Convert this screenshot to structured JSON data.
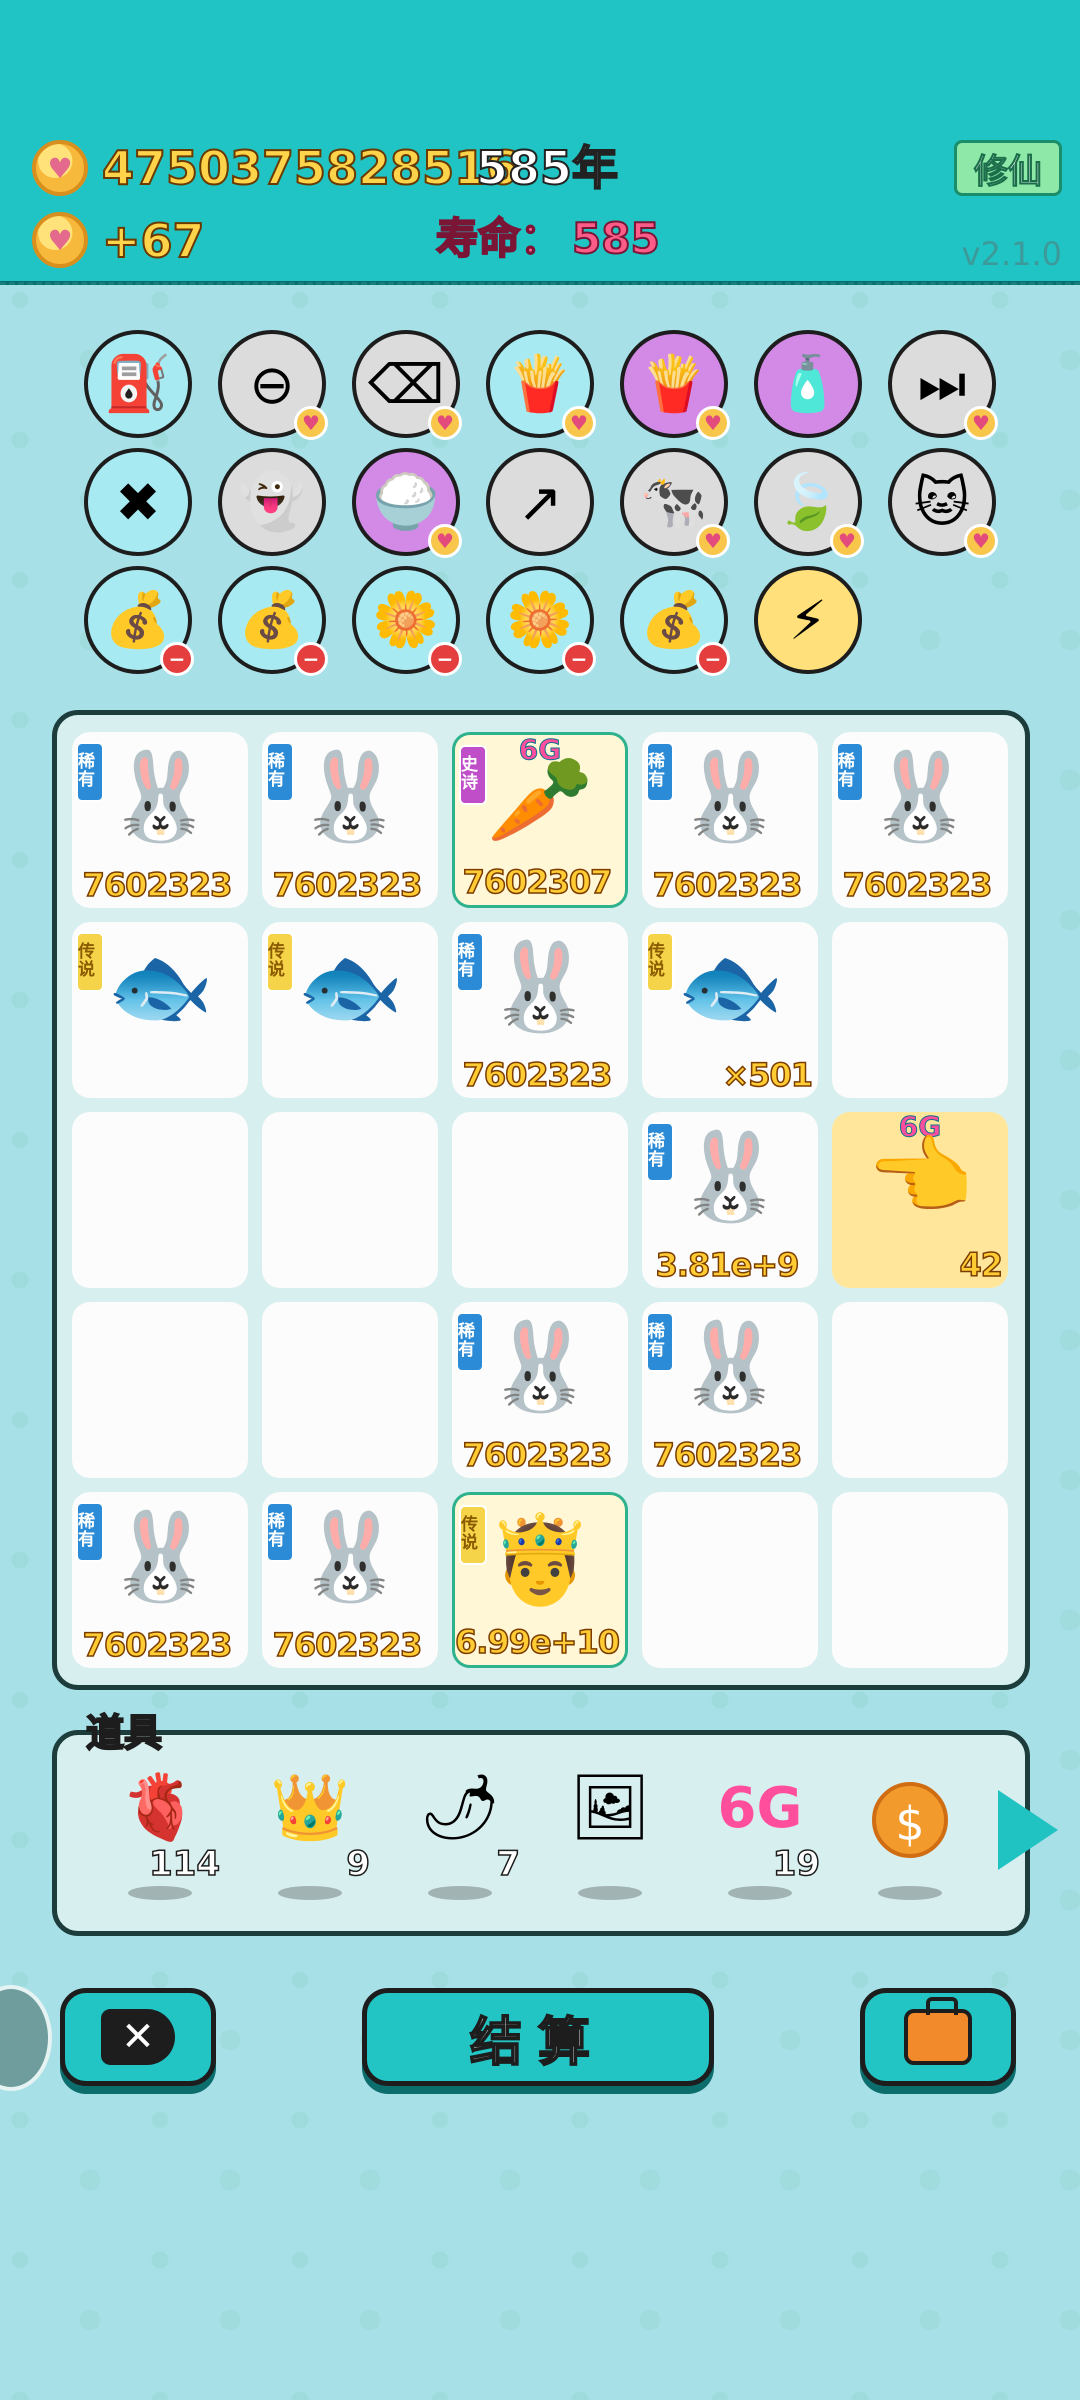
{
  "header": {
    "coins": "4750375828516",
    "years": "585年",
    "income": "+67",
    "lifespan_label": "寿命：",
    "lifespan_value": "585",
    "xiuxian_button": "修仙",
    "version": "v2.1.0"
  },
  "skills": [
    {
      "icon": "pump-icon",
      "glyph": "⛽",
      "bg": "#a8eaf2",
      "corner": ""
    },
    {
      "icon": "minus-circle-icon",
      "glyph": "⊖",
      "bg": "#dcdcdc",
      "corner": "heart"
    },
    {
      "icon": "delete-tag-icon",
      "glyph": "⌫",
      "bg": "#dcdcdc",
      "corner": "heart"
    },
    {
      "icon": "fries-icon",
      "glyph": "🍟",
      "bg": "#a8eaf2",
      "corner": "heart"
    },
    {
      "icon": "fries-icon",
      "glyph": "🍟",
      "bg": "#d389e6",
      "corner": "heart"
    },
    {
      "icon": "spray-bottle-icon",
      "glyph": "🧴",
      "bg": "#d389e6",
      "corner": ""
    },
    {
      "icon": "skip-icon",
      "glyph": "⏭",
      "bg": "#dcdcdc",
      "corner": "heart"
    },
    {
      "icon": "chopsticks-icon",
      "glyph": "✖",
      "bg": "#a8eaf2",
      "corner": ""
    },
    {
      "icon": "ghost-icon",
      "glyph": "👻",
      "bg": "#dcdcdc",
      "corner": ""
    },
    {
      "icon": "rice-bowl-icon",
      "glyph": "🍚",
      "bg": "#d389e6",
      "corner": "heart"
    },
    {
      "icon": "arrow-box-icon",
      "glyph": "↗",
      "bg": "#dcdcdc",
      "corner": ""
    },
    {
      "icon": "cow-icon",
      "glyph": "🐄",
      "bg": "#dcdcdc",
      "corner": "heart"
    },
    {
      "icon": "leaf-icon",
      "glyph": "🍃",
      "bg": "#dcdcdc",
      "corner": "heart"
    },
    {
      "icon": "cat-icon",
      "glyph": "🐱",
      "bg": "#dcdcdc",
      "corner": "heart"
    },
    {
      "icon": "sack-icon",
      "glyph": "💰",
      "bg": "#a8eaf2",
      "corner": "minus"
    },
    {
      "icon": "sack-icon",
      "glyph": "💰",
      "bg": "#a8eaf2",
      "corner": "minus"
    },
    {
      "icon": "flower-pot-icon",
      "glyph": "🌼",
      "bg": "#a8eaf2",
      "corner": "minus"
    },
    {
      "icon": "flower-pot-icon",
      "glyph": "🌼",
      "bg": "#a8eaf2",
      "corner": "minus"
    },
    {
      "icon": "sack-icon",
      "glyph": "💰",
      "bg": "#a8eaf2",
      "corner": "minus"
    },
    {
      "icon": "lightning-icon",
      "glyph": "⚡",
      "bg": "#ffe07a",
      "corner": ""
    }
  ],
  "board": [
    [
      {
        "tag": "稀有",
        "tagClass": "rare",
        "sprite": "🐰",
        "value": "7602323"
      },
      {
        "tag": "稀有",
        "tagClass": "rare",
        "sprite": "🐰",
        "value": "7602323"
      },
      {
        "tag": "史诗",
        "tagClass": "epic",
        "sprite": "🥕",
        "value": "7602307",
        "badge": "6G",
        "special": true
      },
      {
        "tag": "稀有",
        "tagClass": "rare",
        "sprite": "🐰",
        "value": "7602323"
      },
      {
        "tag": "稀有",
        "tagClass": "rare",
        "sprite": "🐰",
        "value": "7602323"
      }
    ],
    [
      {
        "tag": "传说",
        "tagClass": "legend",
        "sprite": "🐟",
        "value": ""
      },
      {
        "tag": "传说",
        "tagClass": "legend",
        "sprite": "🐟",
        "value": ""
      },
      {
        "tag": "稀有",
        "tagClass": "rare",
        "sprite": "🐰",
        "value": "7602323"
      },
      {
        "tag": "传说",
        "tagClass": "legend",
        "sprite": "🐟",
        "value": "×501",
        "right": true
      },
      {}
    ],
    [
      {},
      {},
      {},
      {
        "tag": "稀有",
        "tagClass": "rare",
        "sprite": "🐰",
        "value": "3.81e+9"
      },
      {
        "sprite": "👈",
        "value": "42",
        "badge": "6G",
        "gold": true,
        "right": true
      }
    ],
    [
      {},
      {},
      {
        "tag": "稀有",
        "tagClass": "rare",
        "sprite": "🐰",
        "value": "7602323"
      },
      {
        "tag": "稀有",
        "tagClass": "rare",
        "sprite": "🐰",
        "value": "7602323"
      },
      {}
    ],
    [
      {
        "tag": "稀有",
        "tagClass": "rare",
        "sprite": "🐰",
        "value": "7602323"
      },
      {
        "tag": "稀有",
        "tagClass": "rare",
        "sprite": "🐰",
        "value": "7602323"
      },
      {
        "tag": "传说",
        "tagClass": "legend",
        "sprite": "🤴",
        "value": "6.99e+10",
        "special": true
      },
      {},
      {}
    ]
  ],
  "items_title": "道具",
  "items": [
    {
      "icon": "liver-icon",
      "glyph": "🫀",
      "count": "114"
    },
    {
      "icon": "crown-icon",
      "glyph": "👑",
      "count": "9"
    },
    {
      "icon": "chili-icon",
      "glyph": "🌶",
      "count": "7"
    },
    {
      "icon": "portrait-frame-icon",
      "glyph": "🖼",
      "count": ""
    },
    {
      "icon": "6g-icon",
      "glyph": "6G",
      "count": "19"
    },
    {
      "icon": "dollar-coin-icon",
      "glyph": "$",
      "count": ""
    }
  ],
  "buttons": {
    "delete_glyph": "✕",
    "settle_label": "结算"
  }
}
